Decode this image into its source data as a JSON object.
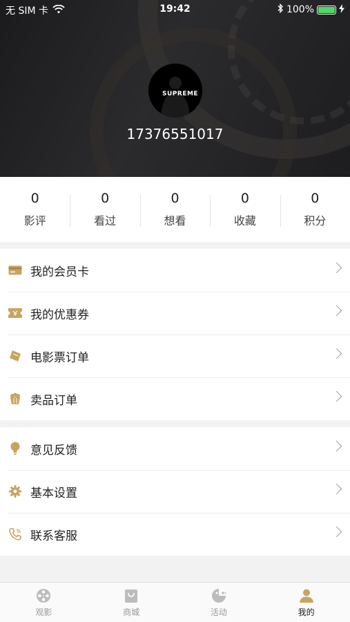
{
  "status_bar": {
    "carrier": "无 SIM 卡",
    "time": "19:42",
    "battery": "100%"
  },
  "profile": {
    "avatar_text": "SUPREME",
    "phone": "17376551017"
  },
  "stats": [
    {
      "value": "0",
      "label": "影评"
    },
    {
      "value": "0",
      "label": "看过"
    },
    {
      "value": "0",
      "label": "想看"
    },
    {
      "value": "0",
      "label": "收藏"
    },
    {
      "value": "0",
      "label": "积分"
    }
  ],
  "menu_group_1": [
    {
      "label": "我的会员卡",
      "icon": "card-icon"
    },
    {
      "label": "我的优惠券",
      "icon": "coupon-icon"
    },
    {
      "label": "电影票订单",
      "icon": "ticket-icon"
    },
    {
      "label": "卖品订单",
      "icon": "popcorn-icon"
    }
  ],
  "menu_group_2": [
    {
      "label": "意见反馈",
      "icon": "bulb-icon"
    },
    {
      "label": "基本设置",
      "icon": "gear-icon"
    },
    {
      "label": "联系客服",
      "icon": "phone-icon"
    }
  ],
  "tabs": [
    {
      "label": "观影",
      "icon": "film-reel-icon",
      "active": false
    },
    {
      "label": "商城",
      "icon": "shopping-bag-icon",
      "active": false
    },
    {
      "label": "活动",
      "icon": "activity-icon",
      "active": false
    },
    {
      "label": "我的",
      "icon": "person-icon",
      "active": true
    }
  ],
  "colors": {
    "accent": "#c9a35f",
    "tab_inactive": "#bcbcbc",
    "battery": "#4cd964"
  }
}
